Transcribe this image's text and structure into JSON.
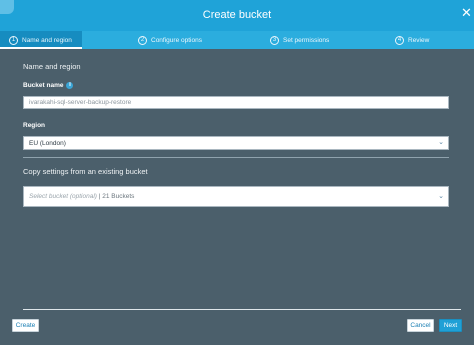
{
  "dialog": {
    "title": "Create bucket",
    "close_glyph": "✕"
  },
  "steps": [
    {
      "number": "1",
      "label": "Name and region",
      "active": true
    },
    {
      "number": "2",
      "label": "Configure options",
      "active": false
    },
    {
      "number": "3",
      "label": "Set permissions",
      "active": false
    },
    {
      "number": "4",
      "label": "Review",
      "active": false
    }
  ],
  "form": {
    "section_title": "Name and region",
    "bucket_name_label": "Bucket name",
    "bucket_name_value": "ivarakahi-sql-server-backup-restore",
    "info_icon": "i",
    "region_label": "Region",
    "region_value": "EU (London)",
    "copy_title": "Copy settings from an existing bucket",
    "copy_placeholder": "Select bucket (optional)",
    "copy_count": "21 Buckets"
  },
  "footer": {
    "create_label": "Create",
    "cancel_label": "Cancel",
    "next_label": "Next"
  },
  "colors": {
    "background": "#4b5f6b",
    "header": "#1fa3d8",
    "primary_button": "#1fa0d6"
  },
  "icons": {
    "info": "info-icon",
    "close": "close-icon",
    "dropdown": "chevron-down-icon"
  }
}
